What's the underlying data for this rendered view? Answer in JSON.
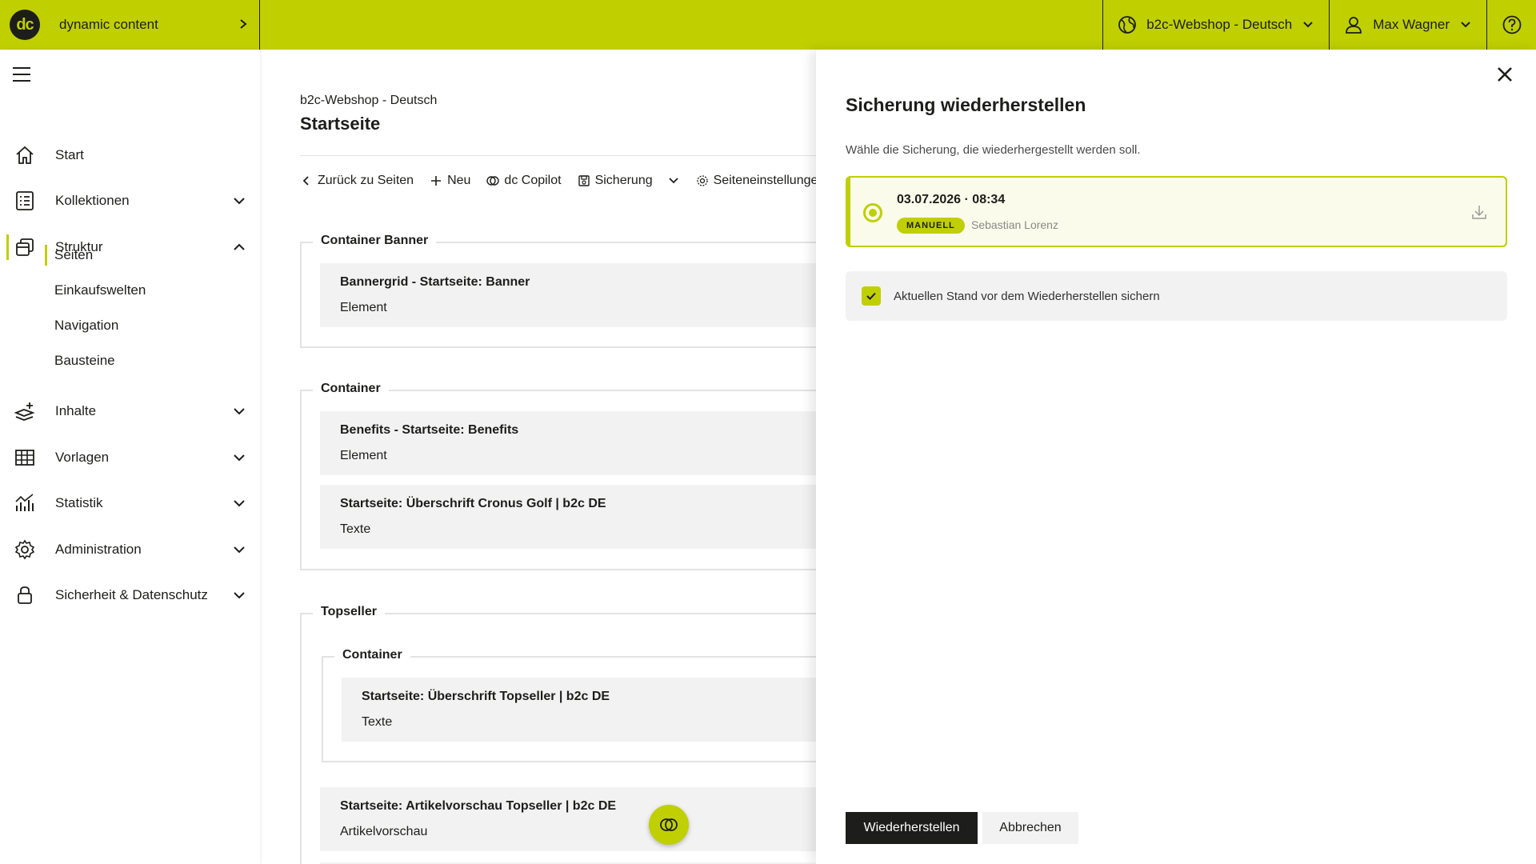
{
  "header": {
    "brand_logo": "dc",
    "brand_name": "dynamic content",
    "shop": "b2c-Webshop - Deutsch",
    "user": "Max Wagner"
  },
  "sidebar": {
    "items": [
      {
        "label": "Start"
      },
      {
        "label": "Kollektionen"
      },
      {
        "label": "Struktur"
      },
      {
        "label": "Inhalte"
      },
      {
        "label": "Vorlagen"
      },
      {
        "label": "Statistik"
      },
      {
        "label": "Administration"
      },
      {
        "label": "Sicherheit & Datenschutz"
      }
    ],
    "subitems": [
      "Seiten",
      "Einkaufswelten",
      "Navigation",
      "Bausteine"
    ]
  },
  "main": {
    "breadcrumb": "b2c-Webshop - Deutsch",
    "title": "Startseite",
    "toolbar": {
      "back": "Zurück zu Seiten",
      "new": "Neu",
      "copilot": "dc Copilot",
      "backup": "Sicherung",
      "settings": "Seiteneinstellungen"
    },
    "sections": [
      {
        "legend": "Container Banner",
        "cards": [
          {
            "title": "Bannergrid - Startseite: Banner",
            "type": "Element"
          }
        ]
      },
      {
        "legend": "Container",
        "cards": [
          {
            "title": "Benefits - Startseite: Benefits",
            "type": "Element"
          },
          {
            "title": "Startseite: Überschrift Cronus Golf | b2c DE",
            "type": "Texte"
          }
        ]
      },
      {
        "legend": "Topseller",
        "nested_legend": "Container",
        "cards": [
          {
            "title": "Startseite: Überschrift Topseller | b2c DE",
            "type": "Texte"
          },
          {
            "title": "Startseite: Artikelvorschau Topseller | b2c DE",
            "type": "Artikelvorschau"
          }
        ]
      }
    ]
  },
  "panel": {
    "title": "Sicherung wiederherstellen",
    "subtitle": "Wähle die Sicherung, die wiederhergestellt werden soll.",
    "backup": {
      "date": "03.07.2026 · 08:34",
      "badge": "MANUELL",
      "user": "Sebastian Lorenz",
      "selected": true
    },
    "checkbox": {
      "label": "Aktuellen Stand vor dem Wiederherstellen sichern",
      "checked": true
    },
    "primary_button": "Wiederherstellen",
    "secondary_button": "Abbrechen"
  },
  "colors": {
    "accent": "#bfcf00",
    "dark": "#1d1d1b",
    "card": "#f2f2f2"
  }
}
